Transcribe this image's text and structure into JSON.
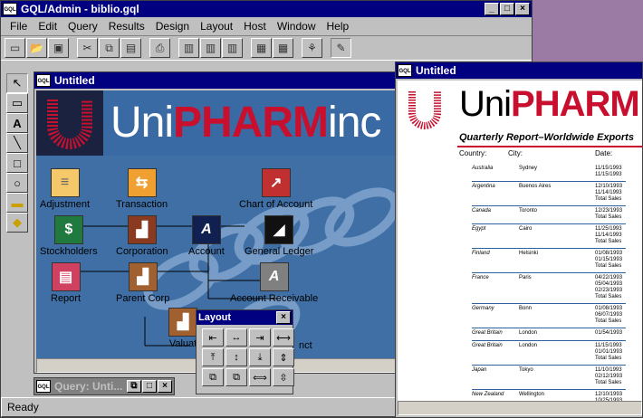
{
  "app": {
    "title": "GQL/Admin - biblio.gql",
    "icon": "GQL"
  },
  "menu": [
    "File",
    "Edit",
    "Query",
    "Results",
    "Design",
    "Layout",
    "Host",
    "Window",
    "Help"
  ],
  "status": "Ready",
  "design_window": {
    "title": "Untitled",
    "banner_pre": "Uni",
    "banner_mid": "PHARM",
    "banner_post": "inc"
  },
  "nodes": {
    "adjustment": "Adjustment",
    "transaction": "Transaction",
    "chart_of_account": "Chart of Account",
    "stockholders": "Stockholders",
    "corporation": "Corporation",
    "account": "Account",
    "general_ledger": "General Ledger",
    "report": "Report",
    "parent_corp": "Parent Corp",
    "account_receivable": "Account Receivable",
    "valuat": "Valuat",
    "nct": "nct"
  },
  "query_window": {
    "title": "Query: Unti..."
  },
  "layout_palette": {
    "title": "Layout"
  },
  "report_window": {
    "title": "Untitled",
    "logo_pre": "Uni",
    "logo_mid": "PHARM",
    "subtitle": "Quarterly Report–Worldwide Exports",
    "col_country": "Country:",
    "col_city": "City:",
    "col_date": "Date:",
    "rows": [
      {
        "country": "Australia",
        "city": "Sydney",
        "dates": "11/15/1993\n11/15/1993"
      },
      {
        "country": "Argentina",
        "city": "Buenos Aires",
        "dates": "12/10/1993\n11/14/1993\nTotal Sales"
      },
      {
        "country": "Canada",
        "city": "Toronto",
        "dates": "12/23/1993\nTotal Sales"
      },
      {
        "country": "Egypt",
        "city": "Cairo",
        "dates": "11/25/1993\n11/14/1993\nTotal Sales"
      },
      {
        "country": "Finland",
        "city": "Helsinki",
        "dates": "01/08/1993\n01/15/1993\nTotal Sales"
      },
      {
        "country": "France",
        "city": "Paris",
        "dates": "04/22/1993\n05/04/1993\n02/23/1993\nTotal Sales"
      },
      {
        "country": "Germany",
        "city": "Bonn",
        "dates": "01/08/1993\n06/07/1993\nTotal Sales"
      },
      {
        "country": "Great Britain",
        "city": "London",
        "dates": "01/54/1993"
      },
      {
        "country": "Great Britain",
        "city": "London",
        "dates": "11/15/1993\n01/01/1993\nTotal Sales"
      },
      {
        "country": "Japan",
        "city": "Tokyo",
        "dates": "11/10/1993\n02/12/1993\nTotal Sales"
      },
      {
        "country": "New Zealand",
        "city": "Wellington",
        "dates": "12/10/1993\n10/25/1993"
      }
    ]
  }
}
